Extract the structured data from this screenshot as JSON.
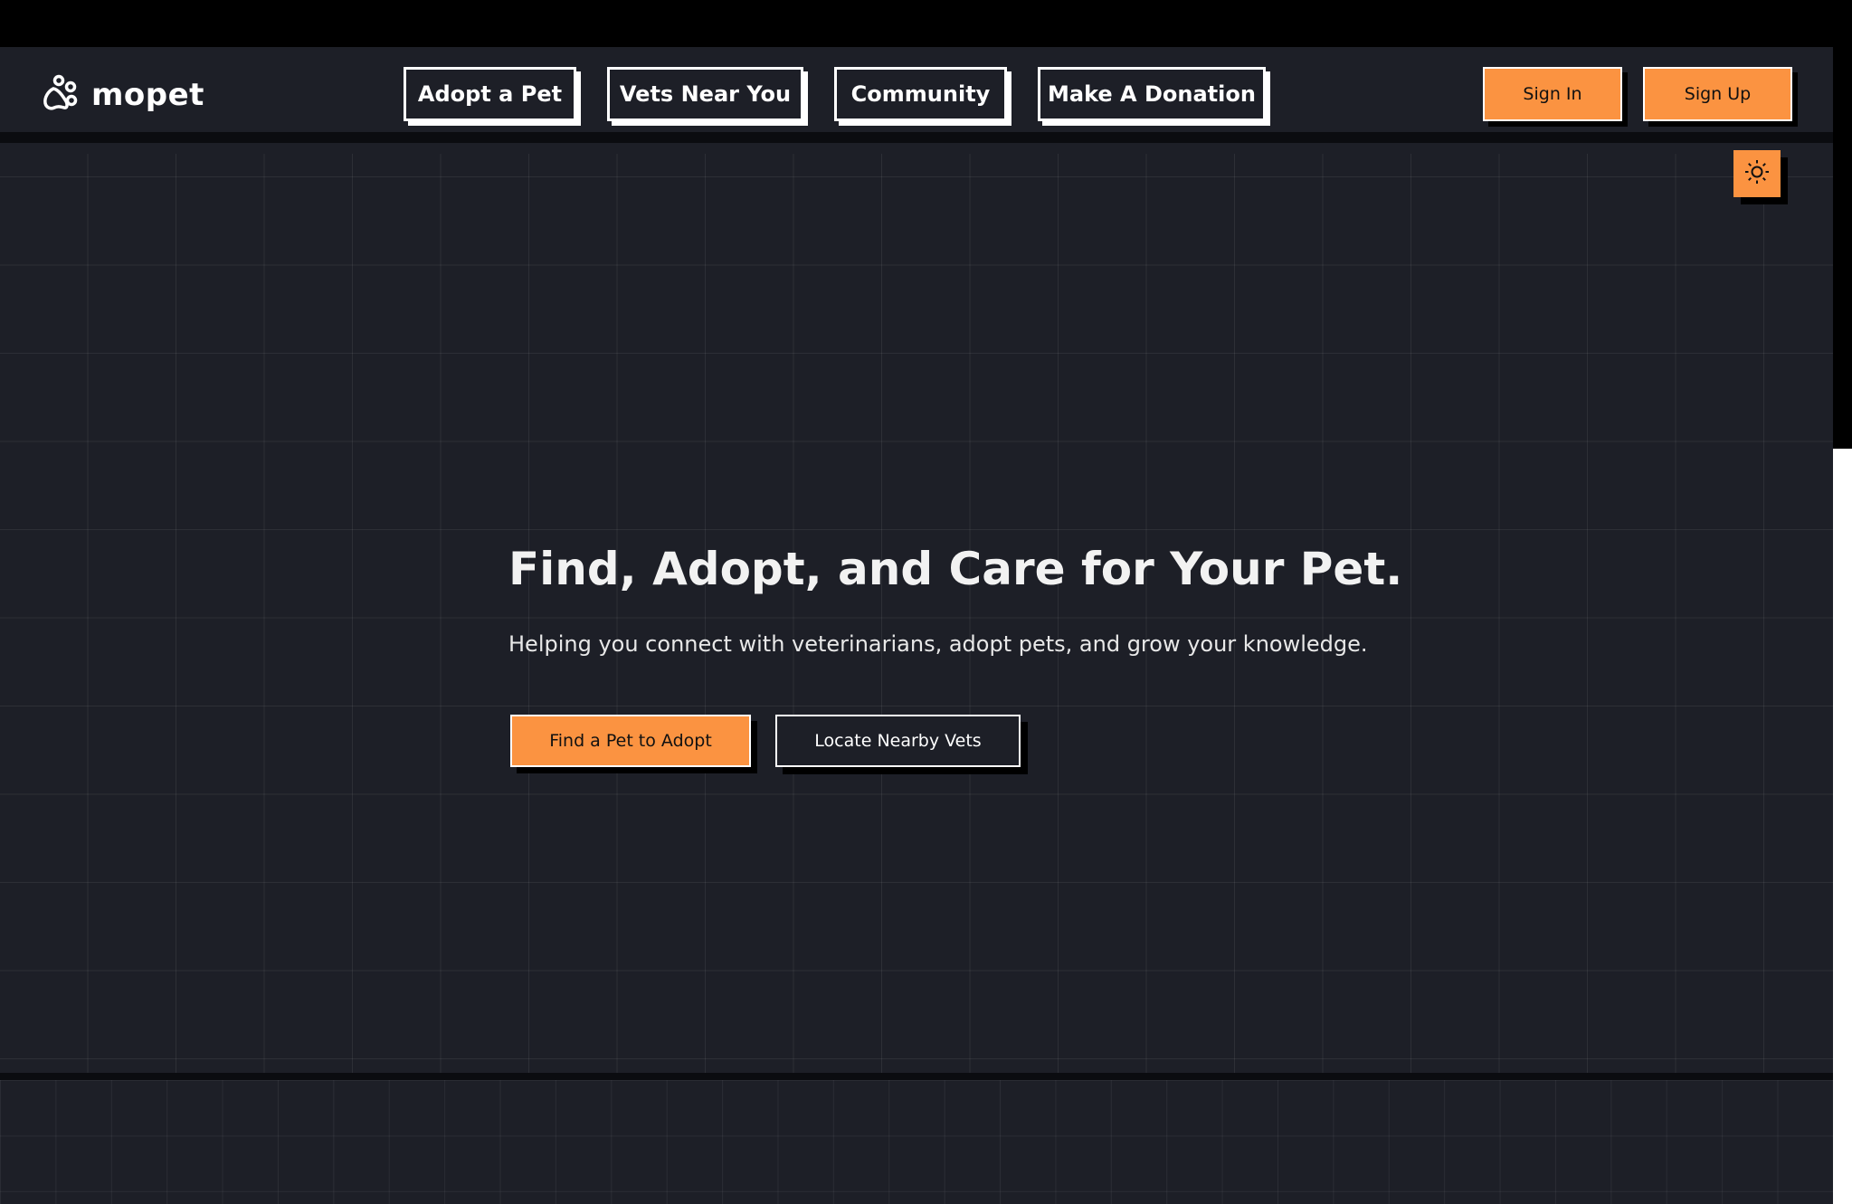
{
  "brand": {
    "name": "mopet",
    "icon": "paw-icon"
  },
  "nav": {
    "items": [
      {
        "label": "Adopt a Pet"
      },
      {
        "label": "Vets Near You"
      },
      {
        "label": "Community"
      },
      {
        "label": "Make A Donation"
      }
    ]
  },
  "auth": {
    "sign_in": "Sign In",
    "sign_up": "Sign Up"
  },
  "theme_toggle": {
    "icon": "sun-icon"
  },
  "hero": {
    "title": "Find, Adopt, and Care for Your Pet.",
    "subtitle": "Helping you connect with veterinarians, adopt pets, and grow your knowledge.",
    "primary_cta": "Find a Pet to Adopt",
    "secondary_cta": "Locate Nearby Vets"
  },
  "colors": {
    "accent": "#fb9341",
    "background": "#1d1f27",
    "text": "#ffffff"
  }
}
